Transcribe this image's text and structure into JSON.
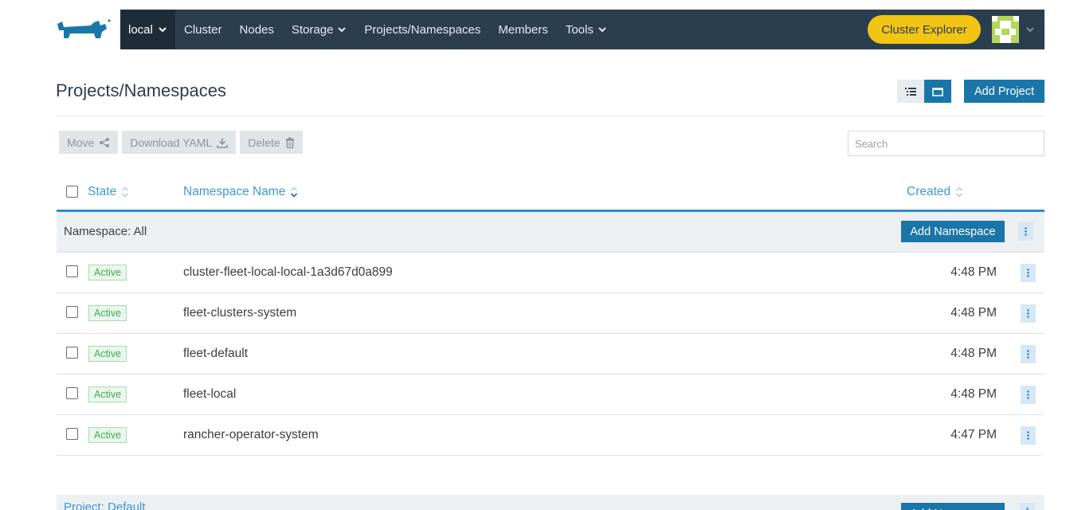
{
  "nav": {
    "cluster": "local",
    "items": [
      {
        "label": "Cluster",
        "dropdown": false
      },
      {
        "label": "Nodes",
        "dropdown": false
      },
      {
        "label": "Storage",
        "dropdown": true
      },
      {
        "label": "Projects/Namespaces",
        "dropdown": false
      },
      {
        "label": "Members",
        "dropdown": false
      },
      {
        "label": "Tools",
        "dropdown": true
      }
    ],
    "explorer_label": "Cluster Explorer"
  },
  "header": {
    "title": "Projects/Namespaces",
    "add_project_label": "Add Project"
  },
  "bulk": {
    "move_label": "Move",
    "download_label": "Download YAML",
    "delete_label": "Delete"
  },
  "search": {
    "placeholder": "Search"
  },
  "table": {
    "columns": {
      "state": "State",
      "name": "Namespace Name",
      "created": "Created"
    },
    "group_label": "Namespace: All",
    "add_namespace_label": "Add Namespace",
    "rows": [
      {
        "state": "Active",
        "name": "cluster-fleet-local-local-1a3d67d0a899",
        "created": "4:48 PM"
      },
      {
        "state": "Active",
        "name": "fleet-clusters-system",
        "created": "4:48 PM"
      },
      {
        "state": "Active",
        "name": "fleet-default",
        "created": "4:48 PM"
      },
      {
        "state": "Active",
        "name": "fleet-local",
        "created": "4:48 PM"
      },
      {
        "state": "Active",
        "name": "rancher-operator-system",
        "created": "4:47 PM"
      }
    ],
    "group2_label": "Project: Default"
  },
  "colors": {
    "nav_bg": "#2b3e50",
    "accent": "#1a76a8",
    "explorer": "#f2c414",
    "active_badge": "#42a85a",
    "link": "#3d98d3"
  }
}
